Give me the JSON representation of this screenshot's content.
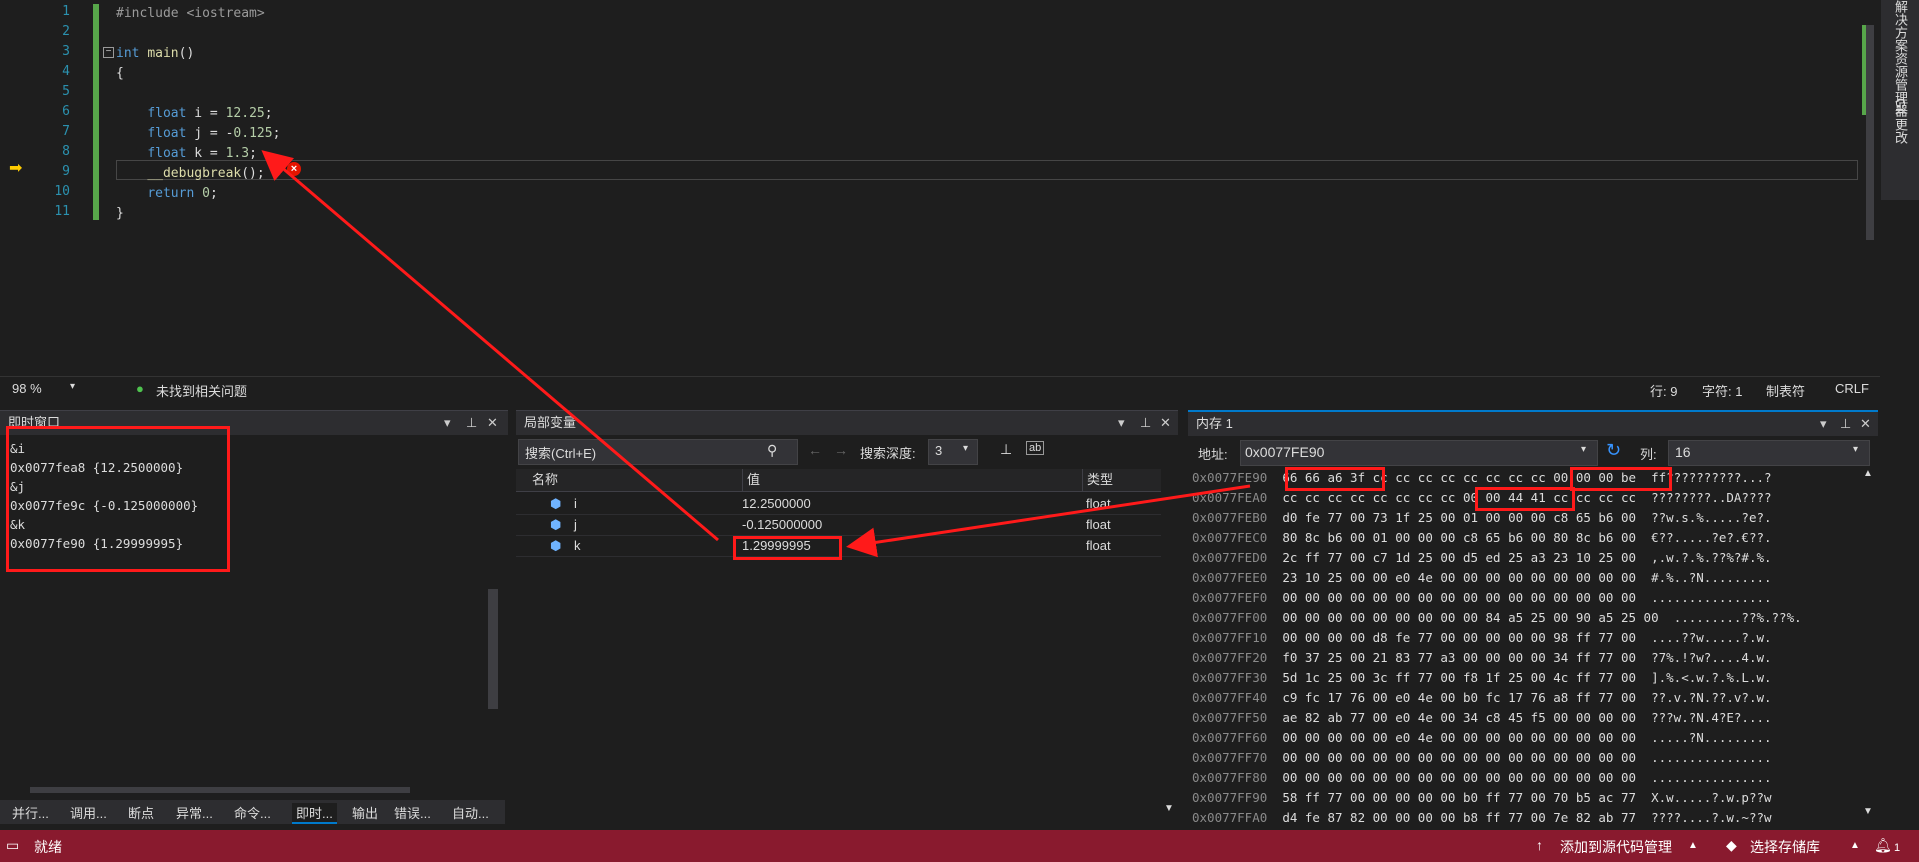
{
  "editor": {
    "lines": [
      {
        "n": "1",
        "html": "<span class=\"inc\">#include &lt;iostream&gt;</span>"
      },
      {
        "n": "2",
        "html": ""
      },
      {
        "n": "3",
        "html": "<span class=\"kw\">int</span> <span class=\"fn\">main</span>()"
      },
      {
        "n": "4",
        "html": "{"
      },
      {
        "n": "5",
        "html": ""
      },
      {
        "n": "6",
        "html": "    <span class=\"kw\">float</span> i = <span class=\"num\">12.25</span>;"
      },
      {
        "n": "7",
        "html": "    <span class=\"kw\">float</span> j = -<span class=\"num\">0.125</span>;"
      },
      {
        "n": "8",
        "html": "    <span class=\"kw\">float</span> k = <span class=\"num\">1.3</span>;"
      },
      {
        "n": "9",
        "html": "    <span class=\"fn\">__debugbreak</span>();"
      },
      {
        "n": "10",
        "html": "    <span class=\"kw\">return</span> <span class=\"num\">0</span>;"
      },
      {
        "n": "11",
        "html": "}"
      }
    ]
  },
  "side_tabs": [
    "解决方案资源管理器",
    "Git 更改"
  ],
  "editor_status": {
    "zoom": "98 %",
    "issues": "未找到相关问题",
    "line": "行: 9",
    "char": "字符: 1",
    "tabs": "制表符",
    "eol": "CRLF"
  },
  "immediate": {
    "title": "即时窗口",
    "lines": [
      "&i",
      "0x0077fea8 {12.2500000}",
      "&j",
      "0x0077fe9c {-0.125000000}",
      "&k",
      "0x0077fe90 {1.29999995}"
    ]
  },
  "locals": {
    "title": "局部变量",
    "search_placeholder": "搜索(Ctrl+E)",
    "depth_label": "搜索深度:",
    "depth_value": "3",
    "col_name": "名称",
    "col_value": "值",
    "col_type": "类型",
    "rows": [
      {
        "name": "i",
        "value": "12.2500000",
        "type": "float"
      },
      {
        "name": "j",
        "value": "-0.125000000",
        "type": "float"
      },
      {
        "name": "k",
        "value": "1.29999995",
        "type": "float"
      }
    ]
  },
  "memory": {
    "title": "内存 1",
    "addr_label": "地址:",
    "addr_value": "0x0077FE90",
    "cols_label": "列:",
    "cols_value": "16",
    "rows": [
      {
        "a": "0x0077FE90",
        "h": "66 66 a6 3f cc cc cc cc cc cc cc cc 00 00 00 be",
        "t": "ff??????????...?"
      },
      {
        "a": "0x0077FEA0",
        "h": "cc cc cc cc cc cc cc cc 00 00 44 41 cc cc cc cc",
        "t": "????????..DA????"
      },
      {
        "a": "0x0077FEB0",
        "h": "d0 fe 77 00 73 1f 25 00 01 00 00 00 c8 65 b6 00",
        "t": "??w.s.%.....?e?."
      },
      {
        "a": "0x0077FEC0",
        "h": "80 8c b6 00 01 00 00 00 c8 65 b6 00 80 8c b6 00",
        "t": "€??.....?e?.€??."
      },
      {
        "a": "0x0077FED0",
        "h": "2c ff 77 00 c7 1d 25 00 d5 ed 25 a3 23 10 25 00",
        "t": ",.w.?.%.??%?#.%."
      },
      {
        "a": "0x0077FEE0",
        "h": "23 10 25 00 00 e0 4e 00 00 00 00 00 00 00 00 00",
        "t": "#.%..?N........."
      },
      {
        "a": "0x0077FEF0",
        "h": "00 00 00 00 00 00 00 00 00 00 00 00 00 00 00 00",
        "t": "................"
      },
      {
        "a": "0x0077FF00",
        "h": "00 00 00 00 00 00 00 00 00 84 a5 25 00 90 a5 25 00",
        "t": ".........??%.??%."
      },
      {
        "a": "0x0077FF10",
        "h": "00 00 00 00 d8 fe 77 00 00 00 00 00 98 ff 77 00",
        "t": "....??w.....?.w."
      },
      {
        "a": "0x0077FF20",
        "h": "f0 37 25 00 21 83 77 a3 00 00 00 00 34 ff 77 00",
        "t": "?7%.!?w?....4.w."
      },
      {
        "a": "0x0077FF30",
        "h": "5d 1c 25 00 3c ff 77 00 f8 1f 25 00 4c ff 77 00",
        "t": "].%.<.w.?.%.L.w."
      },
      {
        "a": "0x0077FF40",
        "h": "c9 fc 17 76 00 e0 4e 00 b0 fc 17 76 a8 ff 77 00",
        "t": "??.v.?N.??.v?.w."
      },
      {
        "a": "0x0077FF50",
        "h": "ae 82 ab 77 00 e0 4e 00 34 c8 45 f5 00 00 00 00",
        "t": "???w.?N.4?E?...."
      },
      {
        "a": "0x0077FF60",
        "h": "00 00 00 00 00 e0 4e 00 00 00 00 00 00 00 00 00",
        "t": ".....?N........."
      },
      {
        "a": "0x0077FF70",
        "h": "00 00 00 00 00 00 00 00 00 00 00 00 00 00 00 00",
        "t": "................"
      },
      {
        "a": "0x0077FF80",
        "h": "00 00 00 00 00 00 00 00 00 00 00 00 00 00 00 00",
        "t": "................"
      },
      {
        "a": "0x0077FF90",
        "h": "58 ff 77 00 00 00 00 00 b0 ff 77 00 70 b5 ac 77",
        "t": "X.w.....?.w.p??w"
      },
      {
        "a": "0x0077FFA0",
        "h": "d4 fe 87 82 00 00 00 00 b8 ff 77 00 7e 82 ab 77",
        "t": "????....?.w.~??w"
      }
    ]
  },
  "bottom_tabs": [
    "并行...",
    "调用...",
    "断点",
    "异常...",
    "命令...",
    "即时...",
    "输出",
    "错误...",
    "自动..."
  ],
  "statusbar": {
    "ready": "就绪",
    "add_source": "添加到源代码管理",
    "select_repo": "选择存储库",
    "notif": "1"
  },
  "colors": {
    "status_bg": "#891a2e",
    "annotation": "#ff1a1a"
  }
}
